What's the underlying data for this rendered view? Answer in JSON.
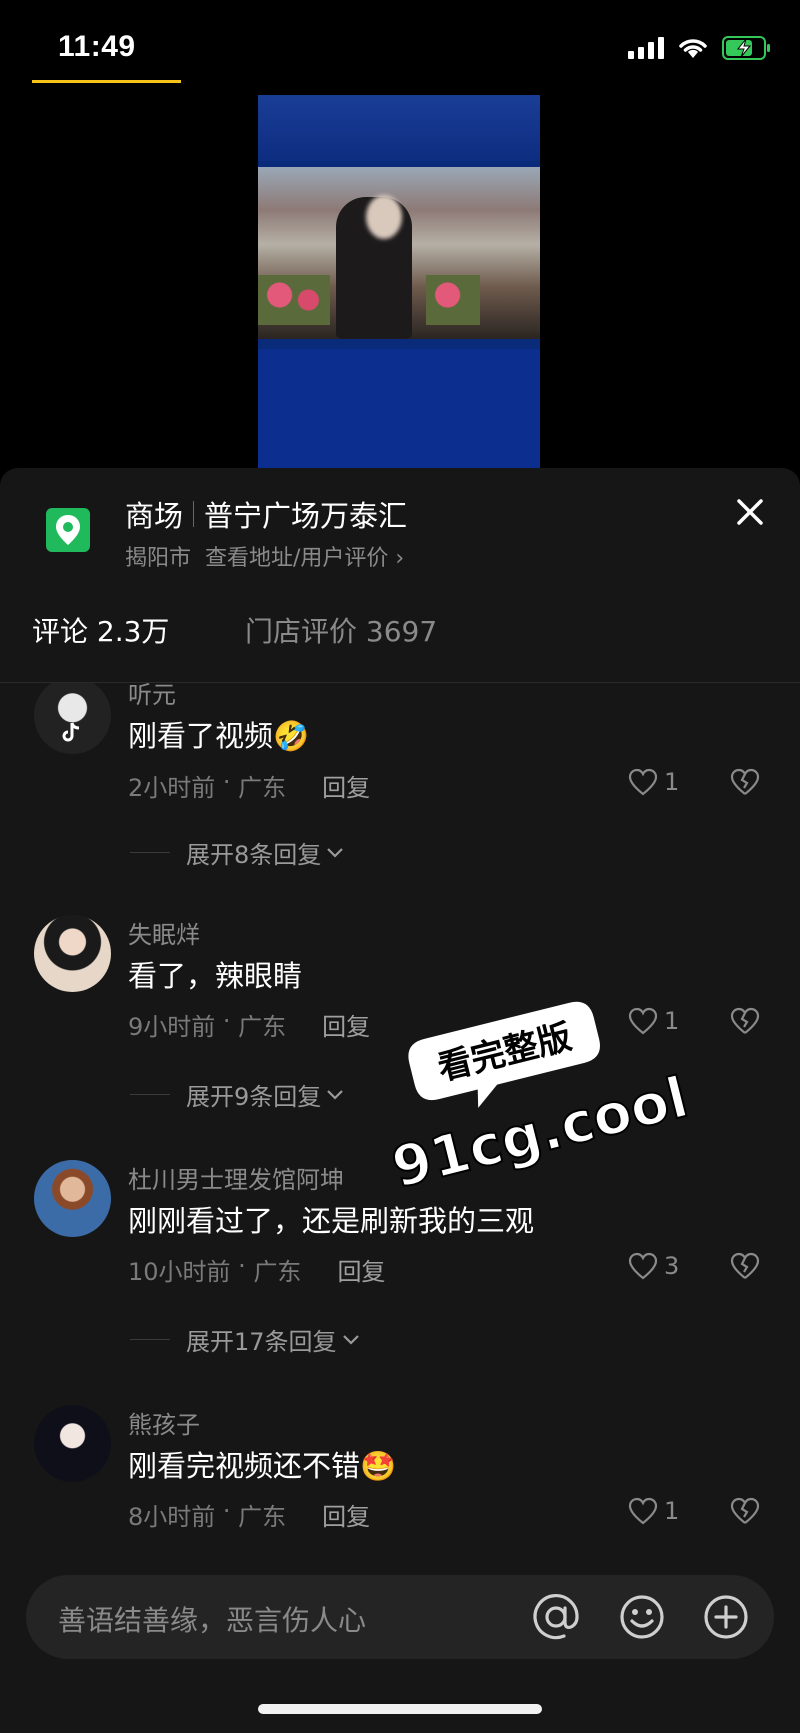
{
  "status_bar": {
    "time": "11:49",
    "battery_charging": true
  },
  "location": {
    "category": "商场",
    "name": "普宁广场万泰汇",
    "city": "揭阳市",
    "detail_link": "查看地址/用户评价",
    "icon": "map-pin-icon",
    "icon_color": "#20b95c"
  },
  "tabs": [
    {
      "label": "评论 2.3万",
      "active": true
    },
    {
      "label": "门店评价 3697",
      "active": false
    }
  ],
  "accent_color": "#f7c21a",
  "comments": [
    {
      "username": "听元",
      "text": "刚看了视频",
      "emoji": "🤣",
      "time": "2小时前",
      "region": "广东",
      "reply_label": "回复",
      "likes": "1",
      "expand_label": "展开8条回复"
    },
    {
      "username": "失眠烊",
      "text": "看了，辣眼睛",
      "emoji": "",
      "time": "9小时前",
      "region": "广东",
      "reply_label": "回复",
      "likes": "1",
      "expand_label": "展开9条回复"
    },
    {
      "username": "杜川男士理发馆阿坤",
      "text": "刚刚看过了，还是刷新我的三观",
      "emoji": "",
      "time": "10小时前",
      "region": "广东",
      "reply_label": "回复",
      "likes": "3",
      "expand_label": "展开17条回复"
    },
    {
      "username": "熊孩子",
      "text": "刚看完视频还不错",
      "emoji": "🤩",
      "time": "8小时前",
      "region": "广东",
      "reply_label": "回复",
      "likes": "1",
      "expand_label": ""
    }
  ],
  "watermark": {
    "bubble_text": "看完整版",
    "domain_text": "91cg.cool"
  },
  "input": {
    "placeholder": "善语结善缘，恶言伤人心"
  },
  "bottom_icons": [
    "at-icon",
    "emoji-icon",
    "plus-icon"
  ]
}
